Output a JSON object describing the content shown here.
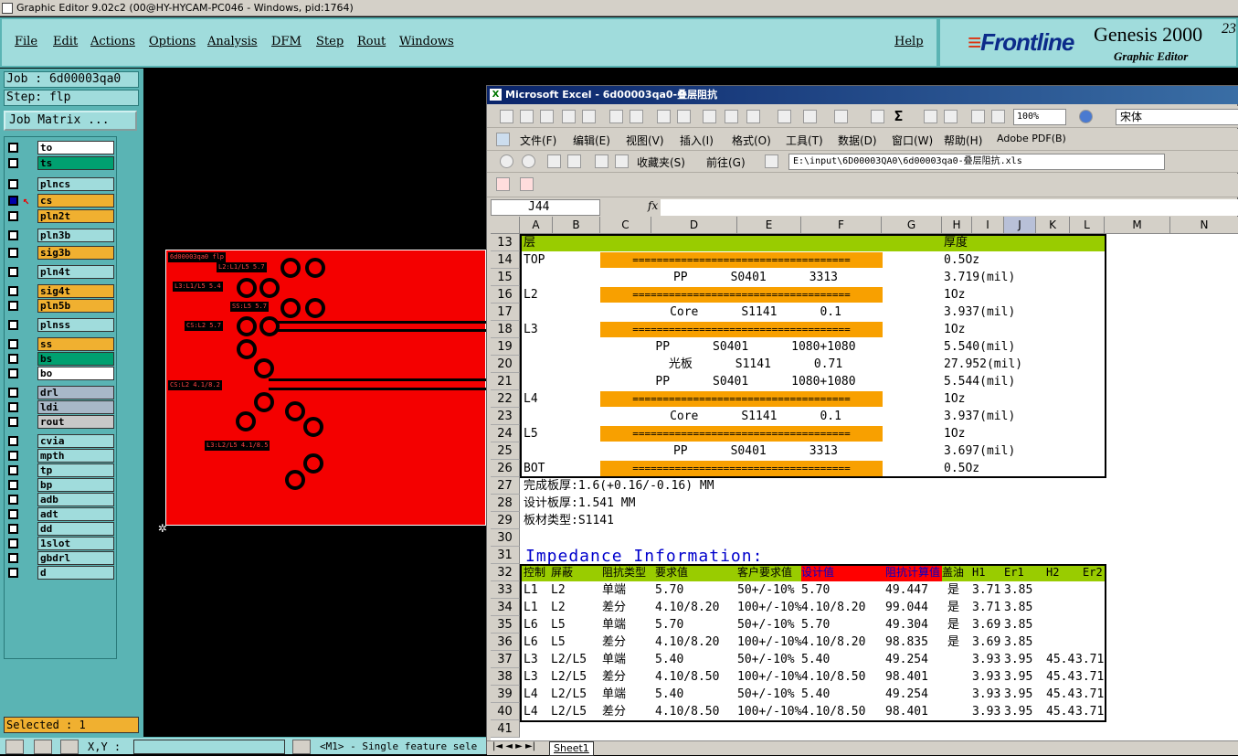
{
  "window": {
    "title": "Graphic Editor 9.02c2 (00@HY-HYCAM-PC046 - Windows, pid:1764)"
  },
  "menubar": {
    "items": [
      "File",
      "Edit",
      "Actions",
      "Options",
      "Analysis",
      "DFM",
      "Step",
      "Rout",
      "Windows"
    ],
    "help": "Help"
  },
  "brand": {
    "logo": "Frontline",
    "product": "Genesis 2000",
    "subtitle": "Graphic Editor",
    "version": "23"
  },
  "left": {
    "job": "Job : 6d00003qa0",
    "step": "Step: flp",
    "job_matrix": "Job Matrix ...",
    "selected": "Selected : 1"
  },
  "layers": [
    {
      "name": "to",
      "color": "#ffffff"
    },
    {
      "name": "ts",
      "color": "#00a070"
    },
    {
      "name": "cs",
      "color": "#f0b030"
    },
    {
      "name": "pln2t",
      "color": "#f0b030"
    },
    {
      "name": "plncs",
      "color": "#a0dcdc"
    },
    {
      "name": "pln3b",
      "color": "#a0dcdc"
    },
    {
      "name": "sig3b",
      "color": "#f0b030"
    },
    {
      "name": "pln4t",
      "color": "#a0dcdc"
    },
    {
      "name": "sig4t",
      "color": "#f0b030"
    },
    {
      "name": "pln5b",
      "color": "#f0b030"
    },
    {
      "name": "plnss",
      "color": "#a0dcdc"
    },
    {
      "name": "ss",
      "color": "#f0b030"
    },
    {
      "name": "bs",
      "color": "#00a070"
    },
    {
      "name": "bo",
      "color": "#ffffff"
    },
    {
      "name": "drl",
      "color": "#a8b8c8"
    },
    {
      "name": "ldi",
      "color": "#a8b8c8"
    },
    {
      "name": "rout",
      "color": "#c8c8c8"
    },
    {
      "name": "cvia",
      "color": "#a0dcdc"
    },
    {
      "name": "mpth",
      "color": "#a0dcdc"
    },
    {
      "name": "tp",
      "color": "#a0dcdc"
    },
    {
      "name": "bp",
      "color": "#a0dcdc"
    },
    {
      "name": "adb",
      "color": "#a0dcdc"
    },
    {
      "name": "adt",
      "color": "#a0dcdc"
    },
    {
      "name": "dd",
      "color": "#a0dcdc"
    },
    {
      "name": "1slot",
      "color": "#a0dcdc"
    },
    {
      "name": "gbdrl",
      "color": "#a0dcdc"
    },
    {
      "name": "d",
      "color": "#a0dcdc"
    }
  ],
  "canvas": {
    "board_labels": [
      "6d00003qa0 flp",
      "L2:L1/L5 5.7",
      "L3:L1/L5 5.4",
      "SS:L5 5.7",
      "CS:L2 5.7",
      "CS:L2 4.1/8.2",
      "L3:L2/L5 4.1/8.5"
    ]
  },
  "statusbar": {
    "coord_label": "X,Y :",
    "message": "<M1> - Single feature sele"
  },
  "excel": {
    "title": "Microsoft Excel - 6d00003qa0-叠层阻抗",
    "menu": [
      "文件(F)",
      "编辑(E)",
      "视图(V)",
      "插入(I)",
      "格式(O)",
      "工具(T)",
      "数据(D)",
      "窗口(W)",
      "帮助(H)",
      "Adobe PDF(B)"
    ],
    "zoom": "100%",
    "font": "宋体",
    "favorites": "收藏夹(S)",
    "goto": "前往(G)",
    "address": "E:\\input\\6D00003QA0\\6d00003qa0-叠层阻抗.xls",
    "namebox": "J44",
    "fx": "fx",
    "columns": [
      "A",
      "B",
      "C",
      "D",
      "E",
      "F",
      "G",
      "H",
      "I",
      "J",
      "K",
      "L",
      "M",
      "N"
    ],
    "sheet_tab": "Sheet1",
    "stackup_header": {
      "layer": "层",
      "thickness": "厚度"
    },
    "stackup": [
      {
        "row": "14",
        "layer": "TOP",
        "mid": "",
        "bar": true,
        "thick": "0.5Oz"
      },
      {
        "row": "15",
        "layer": "",
        "mid": "PP      S0401      3313",
        "bar": false,
        "thick": "3.719(mil)"
      },
      {
        "row": "16",
        "layer": "L2",
        "mid": "",
        "bar": true,
        "thick": "1Oz"
      },
      {
        "row": "17",
        "layer": "",
        "mid": "Core      S1141      0.1",
        "bar": false,
        "thick": "3.937(mil)"
      },
      {
        "row": "18",
        "layer": "L3",
        "mid": "",
        "bar": true,
        "thick": "1Oz"
      },
      {
        "row": "19",
        "layer": "",
        "mid": "PP      S0401      1080+1080",
        "bar": false,
        "thick": "5.540(mil)"
      },
      {
        "row": "20",
        "layer": "",
        "mid": "光板      S1141      0.71",
        "bar": false,
        "thick": "27.952(mil)"
      },
      {
        "row": "21",
        "layer": "",
        "mid": "PP      S0401      1080+1080",
        "bar": false,
        "thick": "5.544(mil)"
      },
      {
        "row": "22",
        "layer": "L4",
        "mid": "",
        "bar": true,
        "thick": "1Oz"
      },
      {
        "row": "23",
        "layer": "",
        "mid": "Core      S1141      0.1",
        "bar": false,
        "thick": "3.937(mil)"
      },
      {
        "row": "24",
        "layer": "L5",
        "mid": "",
        "bar": true,
        "thick": "1Oz"
      },
      {
        "row": "25",
        "layer": "",
        "mid": "PP      S0401      3313",
        "bar": false,
        "thick": "3.697(mil)"
      },
      {
        "row": "26",
        "layer": "BOT",
        "mid": "",
        "bar": true,
        "thick": "0.5Oz"
      }
    ],
    "bar_text": "====================================",
    "info_rows": [
      {
        "row": "27",
        "text": "完成板厚:1.6(+0.16/-0.16) MM"
      },
      {
        "row": "28",
        "text": "设计板厚:1.541 MM"
      },
      {
        "row": "29",
        "text": "板材类型:S1141"
      },
      {
        "row": "30",
        "text": ""
      }
    ],
    "impedance_title": "Impedance Information:",
    "imp_headers": [
      "控制",
      "屏蔽",
      "阻抗类型",
      "要求值",
      "客户要求值",
      "设计值",
      "阻抗计算值",
      "盖油",
      "H1",
      "Er1",
      "H2",
      "Er2"
    ],
    "imp_rows": [
      {
        "row": "33",
        "c": [
          "L1",
          "L2",
          "单端",
          "5.70",
          "50+/-10%",
          "5.70",
          "49.447",
          "是",
          "3.71",
          "3.85",
          "",
          ""
        ]
      },
      {
        "row": "34",
        "c": [
          "L1",
          "L2",
          "差分",
          "4.10/8.20",
          "100+/-10%",
          "4.10/8.20",
          "99.044",
          "是",
          "3.71",
          "3.85",
          "",
          ""
        ]
      },
      {
        "row": "35",
        "c": [
          "L6",
          "L5",
          "单端",
          "5.70",
          "50+/-10%",
          "5.70",
          "49.304",
          "是",
          "3.69",
          "3.85",
          "",
          ""
        ]
      },
      {
        "row": "36",
        "c": [
          "L6",
          "L5",
          "差分",
          "4.10/8.20",
          "100+/-10%",
          "4.10/8.20",
          "98.835",
          "是",
          "3.69",
          "3.85",
          "",
          ""
        ]
      },
      {
        "row": "37",
        "c": [
          "L3",
          "L2/L5",
          "单端",
          "5.40",
          "50+/-10%",
          "5.40",
          "49.254",
          "",
          "3.93",
          "3.95",
          "45.4",
          "3.71"
        ]
      },
      {
        "row": "38",
        "c": [
          "L3",
          "L2/L5",
          "差分",
          "4.10/8.50",
          "100+/-10%",
          "4.10/8.50",
          "98.401",
          "",
          "3.93",
          "3.95",
          "45.4",
          "3.71"
        ]
      },
      {
        "row": "39",
        "c": [
          "L4",
          "L2/L5",
          "单端",
          "5.40",
          "50+/-10%",
          "5.40",
          "49.254",
          "",
          "3.93",
          "3.95",
          "45.4",
          "3.71"
        ]
      },
      {
        "row": "40",
        "c": [
          "L4",
          "L2/L5",
          "差分",
          "4.10/8.50",
          "100+/-10%",
          "4.10/8.50",
          "98.401",
          "",
          "3.93",
          "3.95",
          "45.4",
          "3.71"
        ]
      },
      {
        "row": "41",
        "c": [
          "",
          "",
          "",
          "",
          "",
          "",
          "",
          "",
          "",
          "",
          "",
          ""
        ]
      }
    ],
    "colors": {
      "green": "#99cc00",
      "orange": "#f8a000",
      "red": "#ff0000",
      "blue": "#0000cc"
    }
  }
}
